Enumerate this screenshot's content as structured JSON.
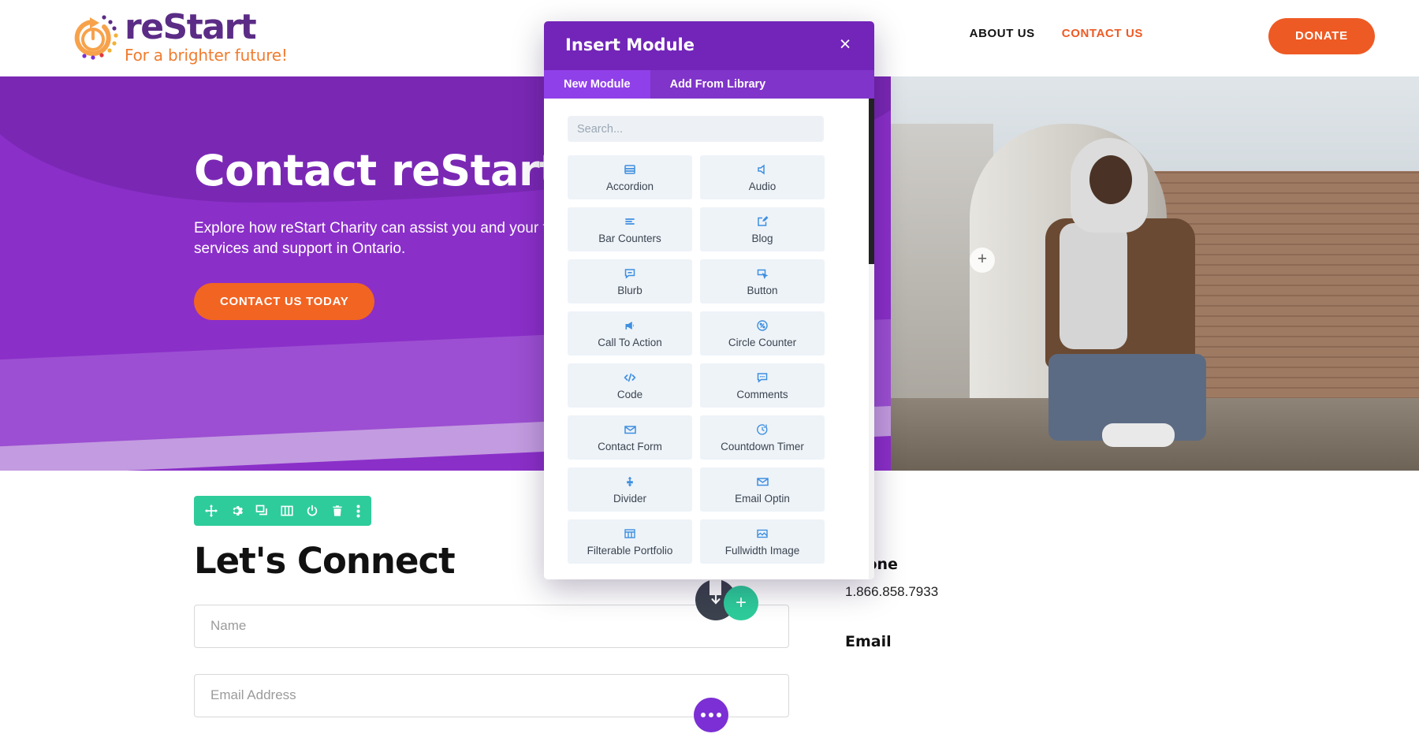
{
  "header": {
    "logo": {
      "word_pre": "re",
      "word_post": "Start",
      "tagline": "For a brighter future!"
    },
    "nav": [
      {
        "label": "ABOUT US",
        "active": false
      },
      {
        "label": "CONTACT US",
        "active": true
      }
    ],
    "donate_label": "DONATE"
  },
  "hero": {
    "title": "Contact reStart",
    "subtitle": "Explore how reStart Charity can assist you and your family. Learn about our services and support in Ontario.",
    "cta_label": "CONTACT US TODAY",
    "plus_label": "+"
  },
  "lower": {
    "section_title": "Let's Connect",
    "row_toolbar_icons": [
      "move-icon",
      "gear-icon",
      "duplicate-icon",
      "columns-icon",
      "power-icon",
      "trash-icon",
      "kebab-menu-icon"
    ],
    "form": {
      "name_placeholder": "Name",
      "email_placeholder": "Email Address"
    },
    "contact": {
      "phone_label": "Phone",
      "phone_value": "1.866.858.7933",
      "email_label": "Email"
    },
    "add_row_label": "+"
  },
  "modal": {
    "title": "Insert Module",
    "close_label": "×",
    "tabs": [
      {
        "label": "New Module",
        "active": true
      },
      {
        "label": "Add From Library",
        "active": false
      }
    ],
    "search": {
      "value": "",
      "placeholder": "Search..."
    },
    "modules": [
      {
        "label": "Accordion",
        "icon": "accordion-icon"
      },
      {
        "label": "Audio",
        "icon": "audio-icon"
      },
      {
        "label": "Bar Counters",
        "icon": "bar-counters-icon"
      },
      {
        "label": "Blog",
        "icon": "blog-icon"
      },
      {
        "label": "Blurb",
        "icon": "blurb-icon"
      },
      {
        "label": "Button",
        "icon": "button-icon"
      },
      {
        "label": "Call To Action",
        "icon": "megaphone-icon"
      },
      {
        "label": "Circle Counter",
        "icon": "circle-counter-icon"
      },
      {
        "label": "Code",
        "icon": "code-icon"
      },
      {
        "label": "Comments",
        "icon": "comments-icon"
      },
      {
        "label": "Contact Form",
        "icon": "envelope-icon"
      },
      {
        "label": "Countdown Timer",
        "icon": "clock-icon"
      },
      {
        "label": "Divider",
        "icon": "divider-icon"
      },
      {
        "label": "Email Optin",
        "icon": "email-optin-icon"
      },
      {
        "label": "Filterable Portfolio",
        "icon": "grid-icon"
      },
      {
        "label": "Fullwidth Image",
        "icon": "image-icon"
      }
    ]
  },
  "colors": {
    "brand_purple": "#5B2C86",
    "brand_orange": "#EE5A24",
    "hero_purple": "#8B2FC9",
    "modal_header": "#7225B8",
    "modal_tab_active": "#9040E8",
    "module_icon_blue": "#3E8FE0",
    "toolbar_teal": "#2ECC9B",
    "fab_purple": "#7B2FD4"
  }
}
